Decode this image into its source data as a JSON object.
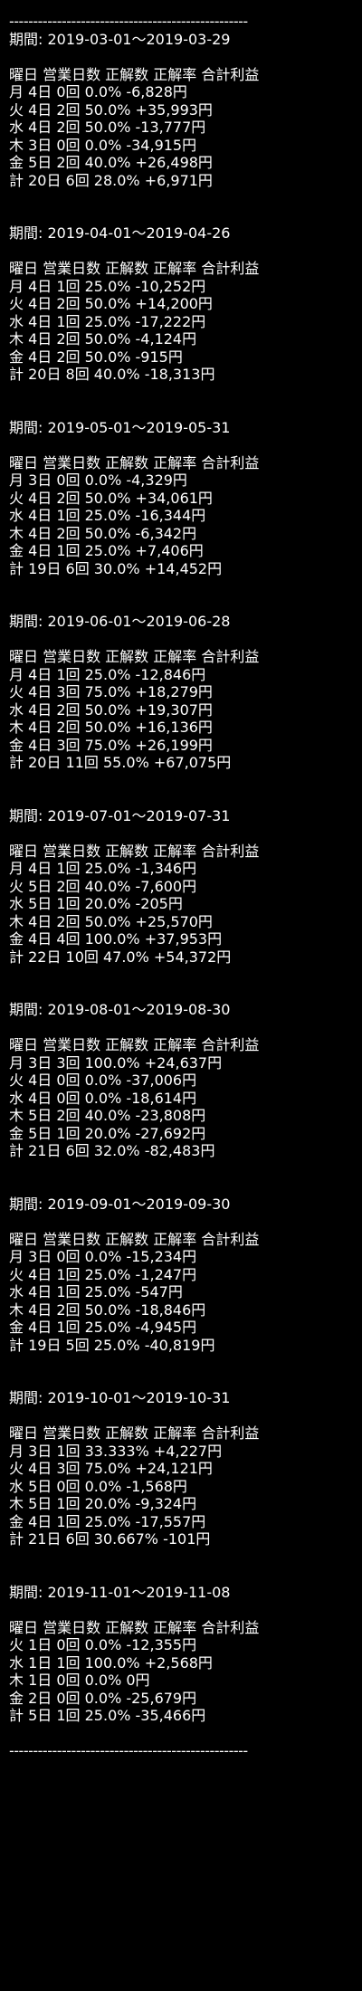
{
  "rule": "--------------------------------------------------",
  "period_label": "期間: ",
  "header": "曜日 営業日数 正解数 正解率 合計利益",
  "periods": [
    {
      "range": "2019-03-01～2019-03-29",
      "rows": [
        "月 4日 0回 0.0% -6,828円",
        "火 4日 2回 50.0% +35,993円",
        "水 4日 2回 50.0% -13,777円",
        "木 3日 0回 0.0% -34,915円",
        "金 5日 2回 40.0% +26,498円",
        "計 20日 6回 28.0% +6,971円"
      ]
    },
    {
      "range": "2019-04-01～2019-04-26",
      "rows": [
        "月 4日 1回 25.0% -10,252円",
        "火 4日 2回 50.0% +14,200円",
        "水 4日 1回 25.0% -17,222円",
        "木 4日 2回 50.0% -4,124円",
        "金 4日 2回 50.0% -915円",
        "計 20日 8回 40.0% -18,313円"
      ]
    },
    {
      "range": "2019-05-01～2019-05-31",
      "rows": [
        "月 3日 0回 0.0% -4,329円",
        "火 4日 2回 50.0% +34,061円",
        "水 4日 1回 25.0% -16,344円",
        "木 4日 2回 50.0% -6,342円",
        "金 4日 1回 25.0% +7,406円",
        "計 19日 6回 30.0% +14,452円"
      ]
    },
    {
      "range": "2019-06-01～2019-06-28",
      "rows": [
        "月 4日 1回 25.0% -12,846円",
        "火 4日 3回 75.0% +18,279円",
        "水 4日 2回 50.0% +19,307円",
        "木 4日 2回 50.0% +16,136円",
        "金 4日 3回 75.0% +26,199円",
        "計 20日 11回 55.0% +67,075円"
      ]
    },
    {
      "range": "2019-07-01～2019-07-31",
      "rows": [
        "月 4日 1回 25.0% -1,346円",
        "火 5日 2回 40.0% -7,600円",
        "水 5日 1回 20.0% -205円",
        "木 4日 2回 50.0% +25,570円",
        "金 4日 4回 100.0% +37,953円",
        "計 22日 10回 47.0% +54,372円"
      ]
    },
    {
      "range": "2019-08-01～2019-08-30",
      "rows": [
        "月 3日 3回 100.0% +24,637円",
        "火 4日 0回 0.0% -37,006円",
        "水 4日 0回 0.0% -18,614円",
        "木 5日 2回 40.0% -23,808円",
        "金 5日 1回 20.0% -27,692円",
        "計 21日 6回 32.0% -82,483円"
      ]
    },
    {
      "range": "2019-09-01～2019-09-30",
      "rows": [
        "月 3日 0回 0.0% -15,234円",
        "火 4日 1回 25.0% -1,247円",
        "水 4日 1回 25.0% -547円",
        "木 4日 2回 50.0% -18,846円",
        "金 4日 1回 25.0% -4,945円",
        "計 19日 5回 25.0% -40,819円"
      ]
    },
    {
      "range": "2019-10-01～2019-10-31",
      "rows": [
        "月 3日 1回 33.333% +4,227円",
        "火 4日 3回 75.0% +24,121円",
        "水 5日 0回 0.0% -1,568円",
        "木 5日 1回 20.0% -9,324円",
        "金 4日 1回 25.0% -17,557円",
        "計 21日 6回 30.667% -101円"
      ]
    },
    {
      "range": "2019-11-01～2019-11-08",
      "rows": [
        "火 1日 0回 0.0% -12,355円",
        "水 1日 1回 100.0% +2,568円",
        "木 1日 0回 0.0% 0円",
        "金 2日 0回 0.0% -25,679円",
        "計 5日 1回 25.0% -35,466円"
      ]
    }
  ]
}
